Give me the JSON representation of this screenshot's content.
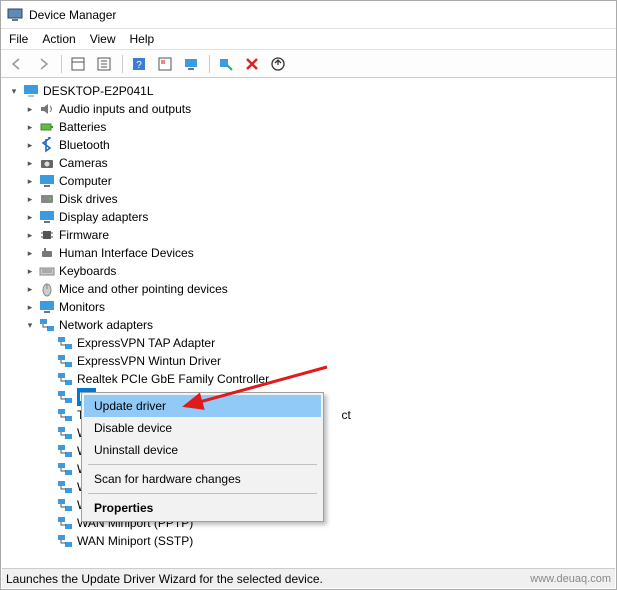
{
  "title": "Device Manager",
  "menubar": {
    "file": "File",
    "action": "Action",
    "view": "View",
    "help": "Help"
  },
  "toolbar": {
    "back": "Back",
    "forward": "Forward",
    "show_hidden": "Show hidden",
    "properties": "Properties",
    "help": "Help",
    "options": "Options",
    "monitor": "Monitor",
    "scan": "Scan for hardware changes",
    "remove": "Uninstall",
    "update": "Update driver"
  },
  "root": {
    "label": "DESKTOP-E2P041L"
  },
  "categories": [
    {
      "label": "Audio inputs and outputs",
      "icon": "speaker"
    },
    {
      "label": "Batteries",
      "icon": "battery"
    },
    {
      "label": "Bluetooth",
      "icon": "bluetooth"
    },
    {
      "label": "Cameras",
      "icon": "camera"
    },
    {
      "label": "Computer",
      "icon": "monitor"
    },
    {
      "label": "Disk drives",
      "icon": "disk"
    },
    {
      "label": "Display adapters",
      "icon": "monitor"
    },
    {
      "label": "Firmware",
      "icon": "chip"
    },
    {
      "label": "Human Interface Devices",
      "icon": "hid"
    },
    {
      "label": "Keyboards",
      "icon": "keyboard"
    },
    {
      "label": "Mice and other pointing devices",
      "icon": "mouse"
    },
    {
      "label": "Monitors",
      "icon": "monitor"
    },
    {
      "label": "Network adapters",
      "icon": "net",
      "expanded": true
    }
  ],
  "network_children": [
    {
      "label": "ExpressVPN TAP Adapter"
    },
    {
      "label": "ExpressVPN Wintun Driver"
    },
    {
      "label": "Realtek PCIe GbE Family Controller"
    },
    {
      "label": "Re",
      "selected": true
    },
    {
      "label": "TA",
      "trail": "ct"
    },
    {
      "label": "W"
    },
    {
      "label": "W"
    },
    {
      "label": "W"
    },
    {
      "label": "W"
    },
    {
      "label": "WAN Miniport (PPPoE)"
    },
    {
      "label": "WAN Miniport (PPTP)"
    },
    {
      "label": "WAN Miniport (SSTP)"
    }
  ],
  "context_menu": {
    "update": "Update driver",
    "disable": "Disable device",
    "uninstall": "Uninstall device",
    "scan": "Scan for hardware changes",
    "properties": "Properties"
  },
  "statusbar": "Launches the Update Driver Wizard for the selected device.",
  "watermark": "www.deuaq.com"
}
